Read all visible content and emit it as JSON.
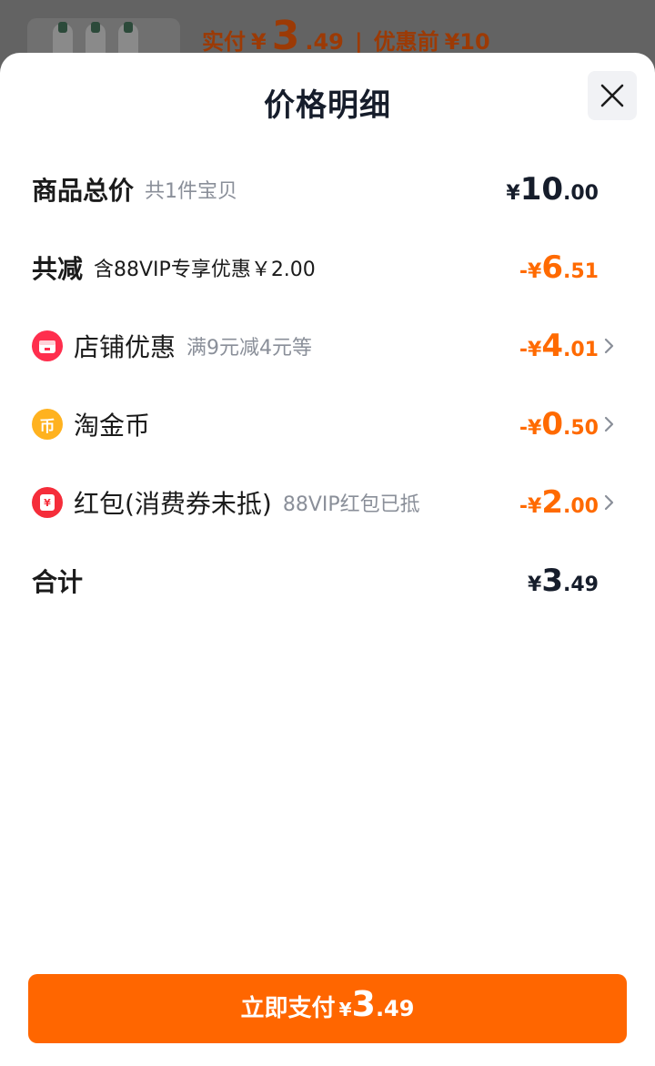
{
  "background": {
    "price_label": "实付",
    "currency": "¥",
    "price_int": "3",
    "price_dec": ".49",
    "separator": "|",
    "before_label": "优惠前",
    "before_price": "¥10"
  },
  "sheet": {
    "title": "价格明细",
    "close_icon": "close-icon"
  },
  "rows": [
    {
      "label": "商品总价",
      "sub": "共1件宝贝",
      "sign": "¥",
      "int": "10",
      "dec": ".00",
      "color": "dark"
    },
    {
      "label": "共减",
      "sub": "含88VIP专享优惠￥2.00",
      "sign": "-¥",
      "int": "6",
      "dec": ".51",
      "color": "orange"
    },
    {
      "label": "店铺优惠",
      "sub": "满9元减4元等",
      "sign": "-¥",
      "int": "4",
      "dec": ".01",
      "icon": "shop-icon",
      "color": "orange"
    },
    {
      "label": "淘金币",
      "sub": "",
      "sign": "-¥",
      "int": "0",
      "dec": ".50",
      "icon": "coin-icon",
      "coin_glyph": "币",
      "color": "orange"
    },
    {
      "label": "红包(消费券未抵)",
      "sub": "88VIP红包已抵",
      "sign": "-¥",
      "int": "2",
      "dec": ".00",
      "icon": "red-packet-icon",
      "packet_glyph": "¥",
      "color": "orange"
    },
    {
      "label": "合计",
      "sub": "",
      "sign": "¥",
      "int": "3",
      "dec": ".49",
      "color": "dark"
    }
  ],
  "pay_button": {
    "label": "立即支付",
    "sign": "¥",
    "int": "3",
    "dec": ".49"
  },
  "colors": {
    "accent": "#ff6600",
    "discount": "#ff6a00",
    "text_dark": "#161d2b",
    "text_muted": "#8a8f99",
    "shop_icon_bg": "#ff2e4d",
    "coin_icon_bg": "#ffb21f",
    "packet_icon_bg": "#f52d3a"
  }
}
